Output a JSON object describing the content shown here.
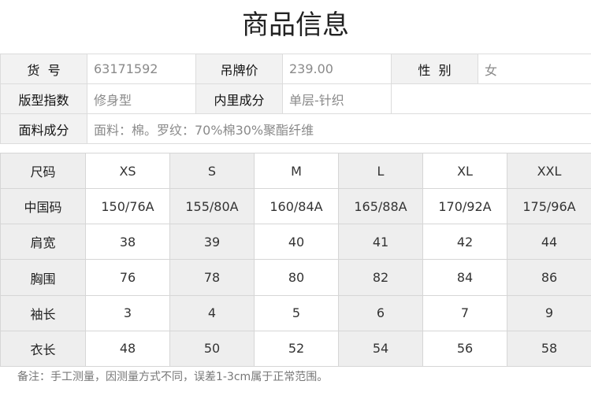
{
  "page_title": "商品信息",
  "info": {
    "item_no_label": "货  号",
    "item_no_value": "63171592",
    "tag_price_label": "吊牌价",
    "tag_price_value": "239.00",
    "gender_label": "性  别",
    "gender_value": "女",
    "fit_label": "版型指数",
    "fit_value": "修身型",
    "lining_label": "内里成分",
    "lining_value": "单层-针织",
    "fabric_label": "面料成分",
    "fabric_value": "面料：棉。罗纹：70%棉30%聚酯纤维"
  },
  "size_table": {
    "header_label": "尺码",
    "sizes": [
      "XS",
      "S",
      "M",
      "L",
      "XL",
      "XXL"
    ],
    "rows": [
      {
        "label": "中国码",
        "values": [
          "150/76A",
          "155/80A",
          "160/84A",
          "165/88A",
          "170/92A",
          "175/96A"
        ]
      },
      {
        "label": "肩宽",
        "values": [
          "38",
          "39",
          "40",
          "41",
          "42",
          "44"
        ]
      },
      {
        "label": "胸围",
        "values": [
          "76",
          "78",
          "80",
          "82",
          "84",
          "86"
        ]
      },
      {
        "label": "袖长",
        "values": [
          "3",
          "4",
          "5",
          "6",
          "7",
          "9"
        ]
      },
      {
        "label": "衣长",
        "values": [
          "48",
          "50",
          "52",
          "54",
          "56",
          "58"
        ]
      }
    ]
  },
  "footnote": "备注：手工测量，因测量方式不同，误差1-3cm属于正常范围。"
}
